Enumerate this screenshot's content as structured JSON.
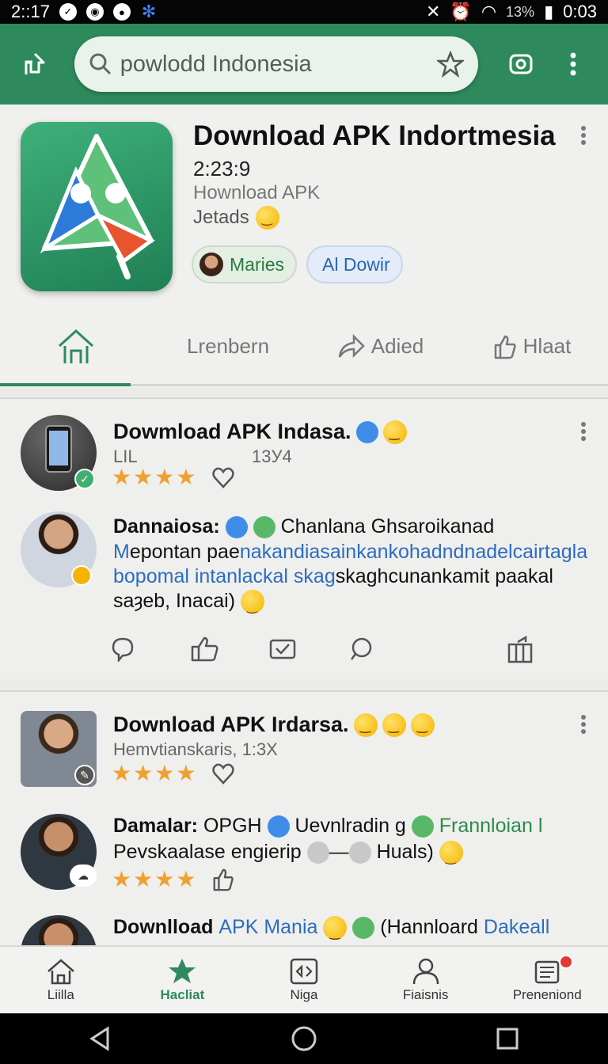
{
  "status_bar": {
    "time": "2::17",
    "battery": "13%",
    "clock": "0:03"
  },
  "search": {
    "query": "powlodd Indonesia"
  },
  "app": {
    "title": "Download APK Indortmesia",
    "line1": "2:23:9",
    "line2": "Hownload APK",
    "line3": "Jetads",
    "chips": [
      "Maries",
      "Al Dowir"
    ]
  },
  "tabs": [
    "",
    "Lrenbern",
    "Adied",
    "Hlaat"
  ],
  "posts": [
    {
      "title": "Dowmload APK Indasa.",
      "meta1": "LIL",
      "meta2": "13У4"
    },
    {
      "title": "Dannaiosa:",
      "title_tail": "Chanlana Ghsaroikanad",
      "line1a": "M",
      "line1b": "epontan pae",
      "line1c": "nakandiasainkankohadndnade",
      "line1d": "lcairtagla",
      "line2a": "bopomal intanlackal skag",
      "line2b": "skaghcunankamit paakal",
      "line3": "saȝeb, Inacai)"
    },
    {
      "title": "Download APK Irdarsa.",
      "meta": "Hemvtianskaris, 1:3X"
    },
    {
      "title": "Damalar:",
      "title_b": "OPGH",
      "title_c": "Uevnlradin g",
      "title_d": "Frannloian l",
      "line1": "Pevskaalase engierip",
      "line1_tail": "Huals)"
    },
    {
      "title_a": "Downlload",
      "title_b": "APK Mania",
      "title_c": "(Hannloard",
      "title_d": "Dakeall"
    }
  ],
  "bottom_nav": [
    "Liilla",
    "Hacliat",
    "Niga",
    "Fiaisnis",
    "Preneniond"
  ]
}
